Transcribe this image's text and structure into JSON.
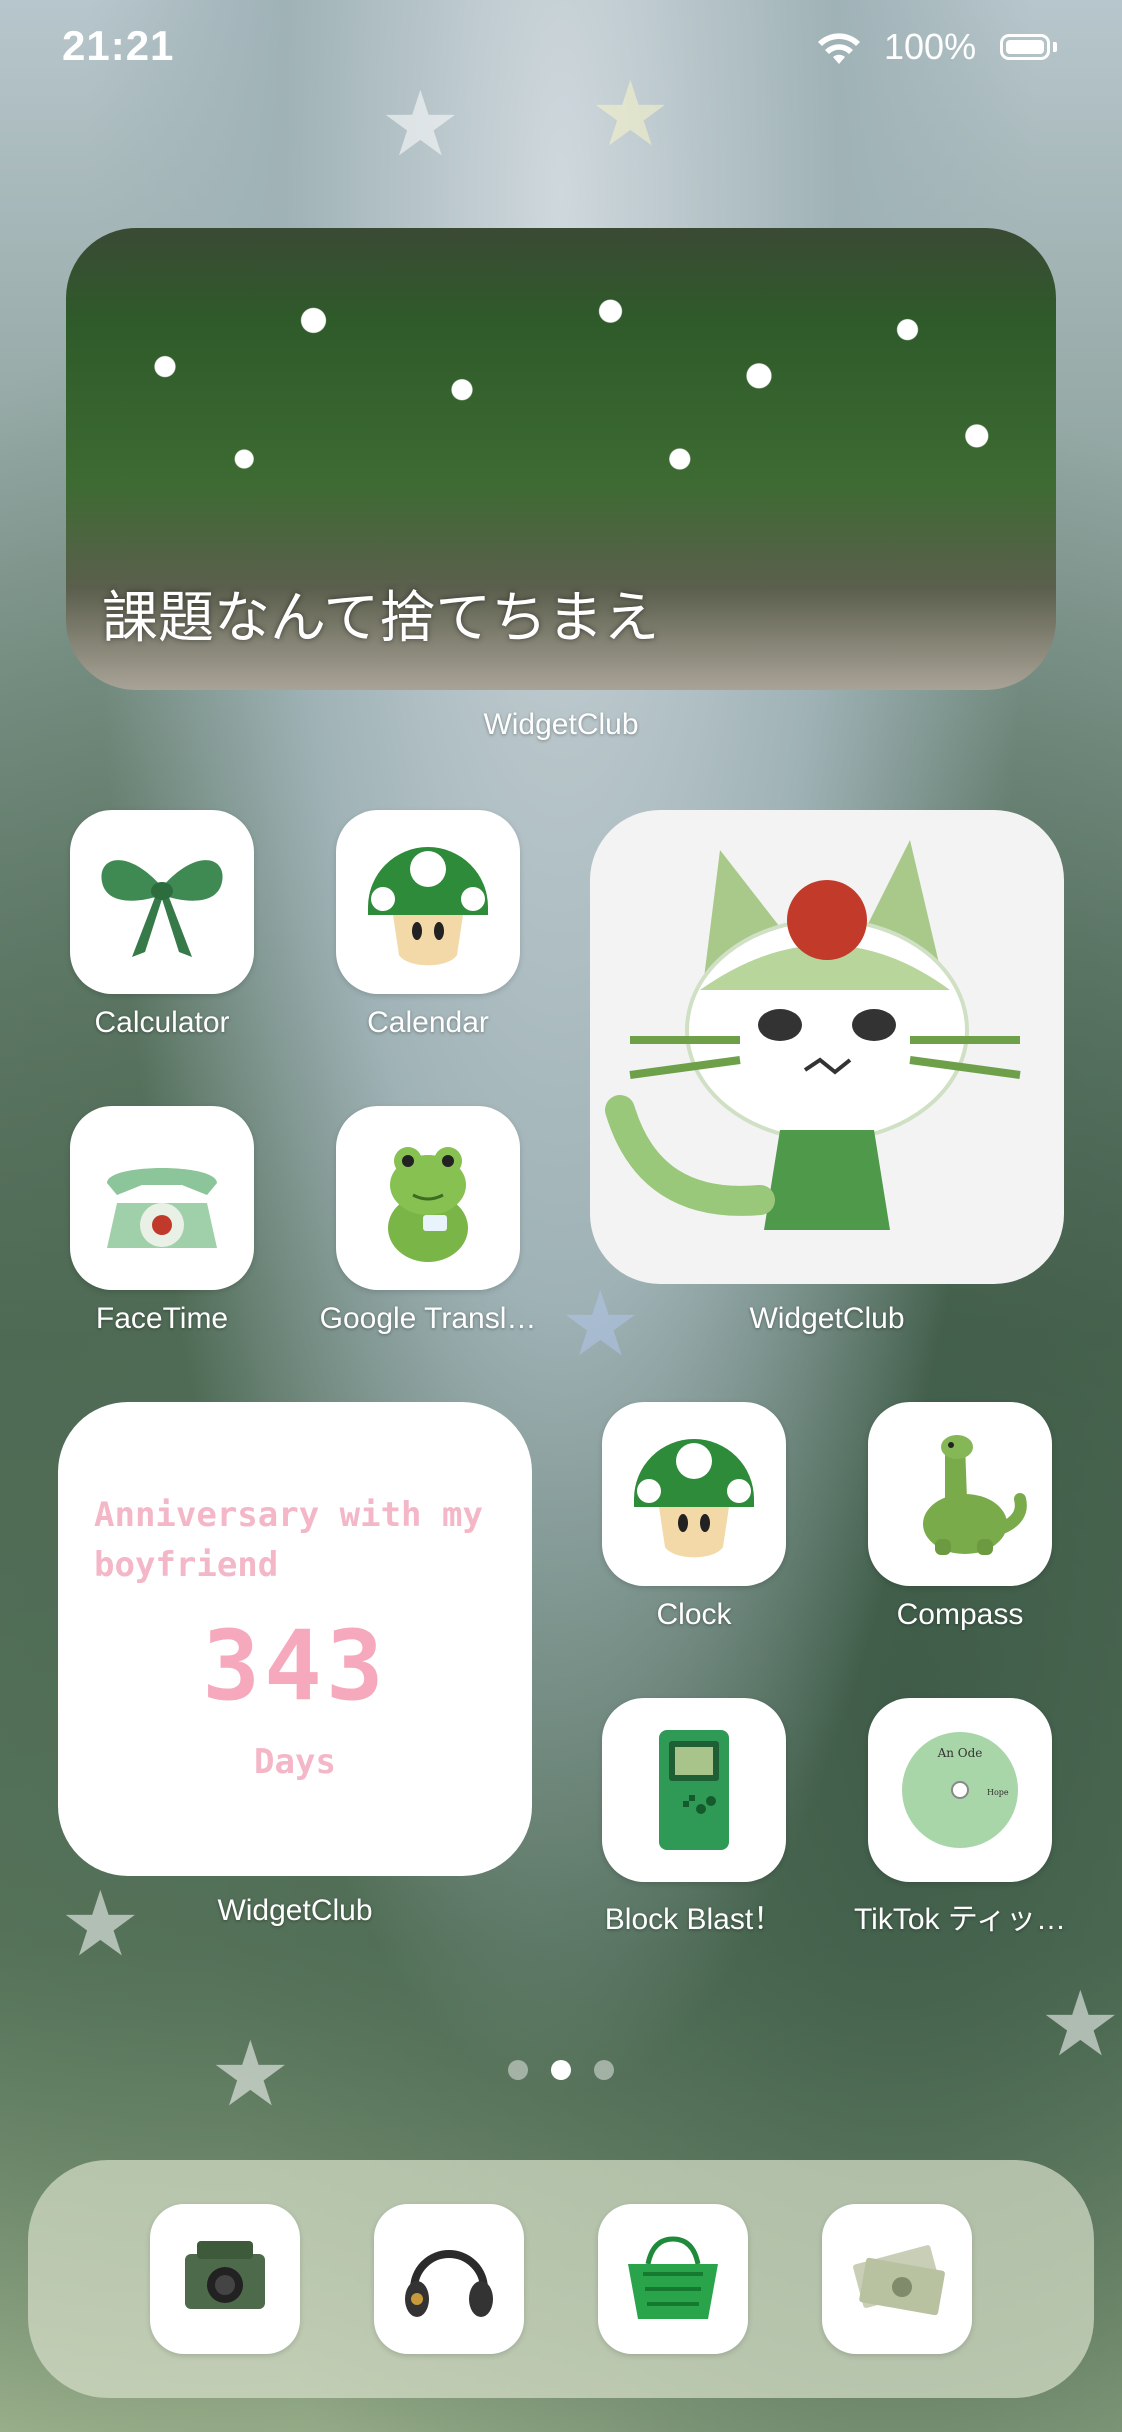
{
  "status_bar": {
    "time": "21:21",
    "battery_percent": "100%",
    "wifi": "wifi-icon",
    "battery": "battery-full-icon"
  },
  "photo_widget": {
    "overlay_text": "課題なんて捨てちまえ",
    "label": "WidgetClub"
  },
  "apps": {
    "calculator": {
      "label": "Calculator",
      "icon": "green-bow-icon"
    },
    "calendar": {
      "label": "Calendar",
      "icon": "green-mushroom-icon"
    },
    "facetime": {
      "label": "FaceTime",
      "icon": "green-telephone-icon"
    },
    "google_translate": {
      "label": "Google Transl…",
      "icon": "frog-plush-icon"
    },
    "clock": {
      "label": "Clock",
      "icon": "green-mushroom-icon"
    },
    "compass": {
      "label": "Compass",
      "icon": "dinosaur-plush-icon"
    },
    "block_blast": {
      "label": "Block Blast！",
      "icon": "green-gameboy-icon"
    },
    "tiktok": {
      "label": "TikTok ティッ…",
      "icon": "record-disc-icon"
    }
  },
  "cat_widget": {
    "label": "WidgetClub",
    "icon": "cat-figure-icon"
  },
  "anniversary_widget": {
    "title": "Anniversary with my boyfriend",
    "count": "343",
    "unit": "Days",
    "label": "WidgetClub"
  },
  "record": {
    "title": "An Ode",
    "subtitle": "Hope"
  },
  "page_indicator": {
    "pages": 3,
    "current": 2
  },
  "dock": [
    {
      "icon": "camera-icon"
    },
    {
      "icon": "headphones-icon"
    },
    {
      "icon": "shopping-basket-icon"
    },
    {
      "icon": "money-icon"
    }
  ],
  "colors": {
    "widget_pink": "#f6a8bd",
    "icon_green": "#3e8a4a"
  }
}
